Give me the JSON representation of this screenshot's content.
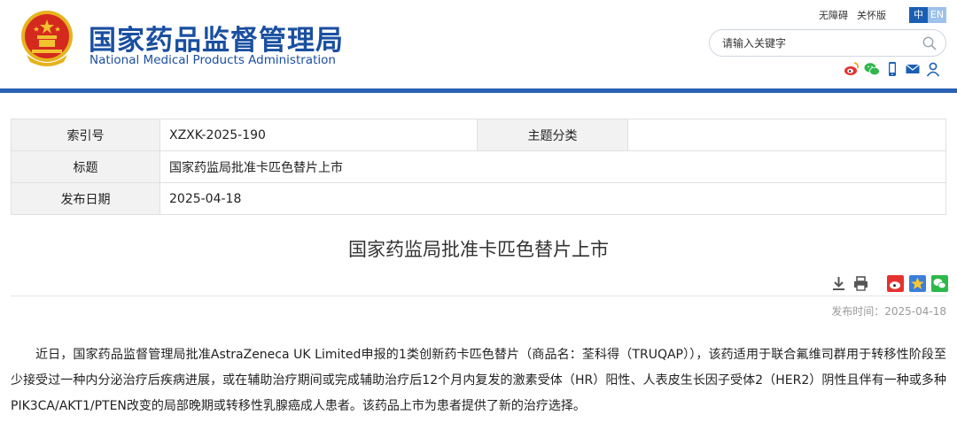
{
  "header": {
    "title_cn": "国家药品监督管理局",
    "title_en": "National Medical Products Administration",
    "links": {
      "accessibility": "无障碍",
      "care": "关怀版"
    },
    "lang": {
      "zh": "中",
      "en": "EN"
    },
    "search": {
      "placeholder": "请输入关键字",
      "icon": "search-icon"
    },
    "social_icons": [
      "weibo-icon",
      "wechat-icon",
      "mobile-icon",
      "mail-icon",
      "user-icon"
    ]
  },
  "info_table": {
    "index_label": "索引号",
    "index_value": "XZXK-2025-190",
    "topic_label": "主题分类",
    "topic_value": "",
    "title_label": "标题",
    "title_value": "国家药监局批准卡匹色替片上市",
    "date_label": "发布日期",
    "date_value": "2025-04-18"
  },
  "article": {
    "title": "国家药监局批准卡匹色替片上市",
    "publish_time": "发布时间：2025-04-18",
    "body": "近日，国家药品监督管理局批准AstraZeneca UK Limited申报的1类创新药卡匹色替片（商品名：荃科得（TRUQAP）），该药适用于联合氟维司群用于转移性阶段至少接受过一种内分泌治疗后疾病进展，或在辅助治疗期间或完成辅助治疗后12个月内复发的激素受体（HR）阳性、人表皮生长因子受体2（HER2）阴性且伴有一种或多种PIK3CA/AKT1/PTEN改变的局部晚期或转移性乳腺癌成人患者。该药品上市为患者提供了新的治疗选择。",
    "tool_icons": [
      "download-icon",
      "print-icon",
      "weibo-share-icon",
      "qzone-share-icon",
      "wechat-share-icon"
    ]
  },
  "colors": {
    "brand": "#1a4fa0",
    "bar": "#2a62b7",
    "emblem_red": "#d42a1e",
    "emblem_gold": "#f2c230"
  }
}
